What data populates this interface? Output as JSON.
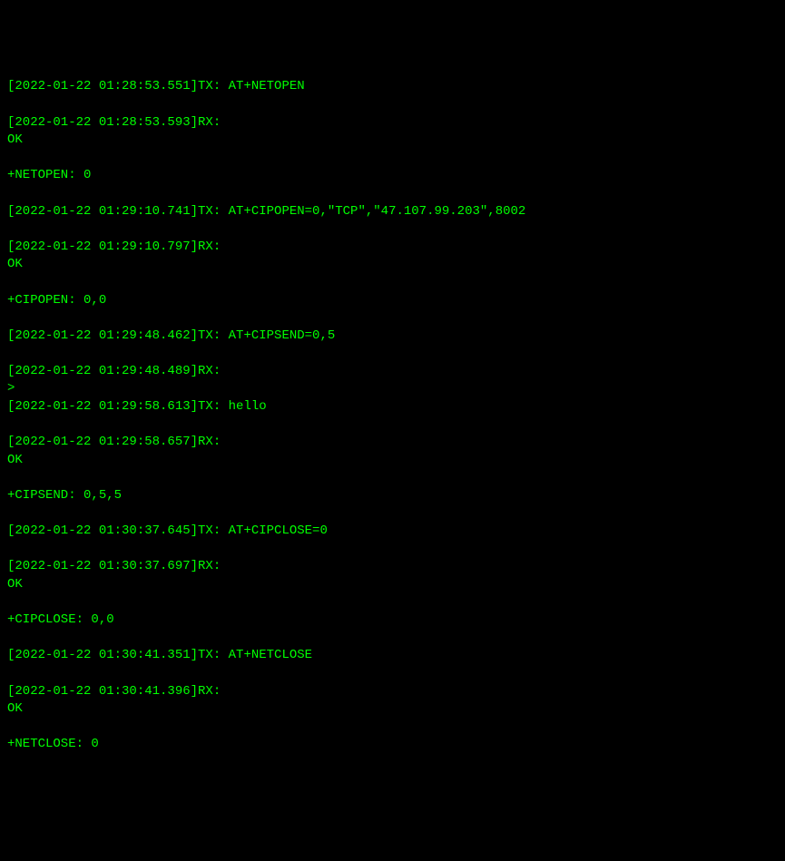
{
  "terminal": {
    "lines": [
      "[2022-01-22 01:28:53.551]TX: AT+NETOPEN",
      "",
      "[2022-01-22 01:28:53.593]RX: ",
      "OK",
      "",
      "+NETOPEN: 0",
      "",
      "[2022-01-22 01:29:10.741]TX: AT+CIPOPEN=0,\"TCP\",\"47.107.99.203\",8002",
      "",
      "[2022-01-22 01:29:10.797]RX: ",
      "OK",
      "",
      "+CIPOPEN: 0,0",
      "",
      "[2022-01-22 01:29:48.462]TX: AT+CIPSEND=0,5",
      "",
      "[2022-01-22 01:29:48.489]RX: ",
      ">",
      "[2022-01-22 01:29:58.613]TX: hello",
      "",
      "[2022-01-22 01:29:58.657]RX: ",
      "OK",
      "",
      "+CIPSEND: 0,5,5",
      "",
      "[2022-01-22 01:30:37.645]TX: AT+CIPCLOSE=0",
      "",
      "[2022-01-22 01:30:37.697]RX: ",
      "OK",
      "",
      "+CIPCLOSE: 0,0",
      "",
      "[2022-01-22 01:30:41.351]TX: AT+NETCLOSE",
      "",
      "[2022-01-22 01:30:41.396]RX: ",
      "OK",
      "",
      "+NETCLOSE: 0",
      ""
    ]
  }
}
